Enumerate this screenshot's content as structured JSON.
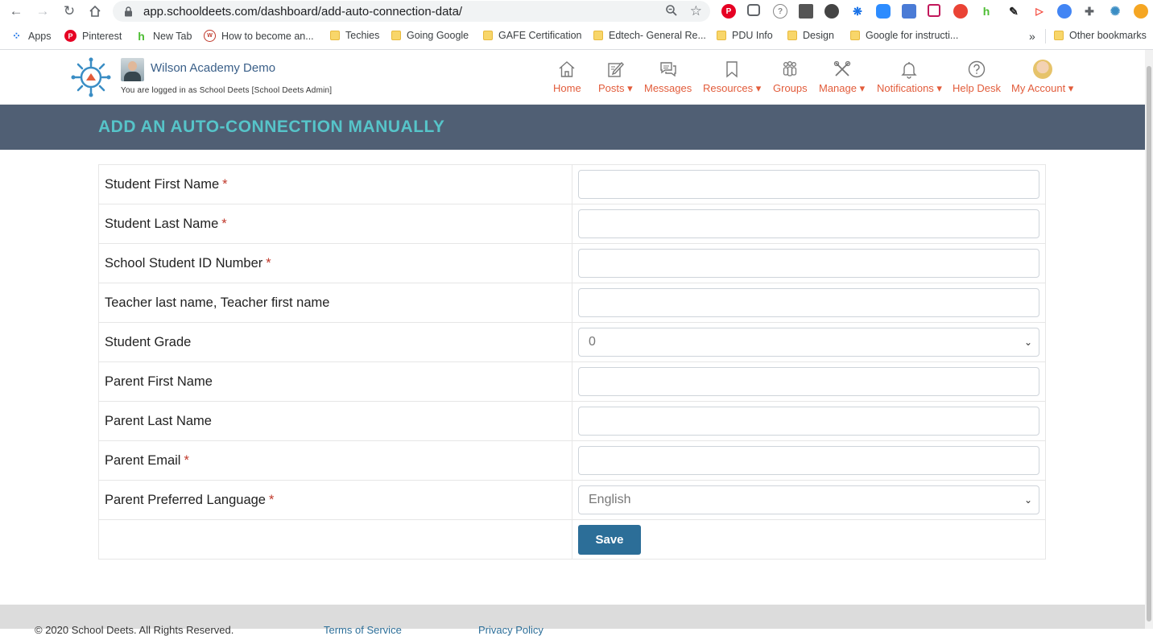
{
  "browser": {
    "url": "app.schooldeets.com/dashboard/add-auto-connection-data/",
    "bookmarks": [
      {
        "label": "Apps",
        "icon": "apps-grid-icon"
      },
      {
        "label": "Pinterest",
        "icon": "pinterest-icon"
      },
      {
        "label": "New Tab",
        "icon": "houzz-icon"
      },
      {
        "label": "How to become an...",
        "icon": "site-icon"
      },
      {
        "label": "Techies",
        "icon": "folder-icon"
      },
      {
        "label": "Going Google",
        "icon": "folder-icon"
      },
      {
        "label": "GAFE Certification",
        "icon": "folder-icon"
      },
      {
        "label": "Edtech- General Re...",
        "icon": "folder-icon"
      },
      {
        "label": "PDU Info",
        "icon": "folder-icon"
      },
      {
        "label": "Design",
        "icon": "folder-icon"
      },
      {
        "label": "Google for instructi...",
        "icon": "folder-icon"
      }
    ],
    "overflow": "»",
    "other_bookmarks": "Other bookmarks"
  },
  "header": {
    "org_name": "Wilson Academy Demo",
    "logged_in_text": "You are logged in as School Deets [School Deets Admin]",
    "nav": [
      {
        "label": "Home",
        "icon": "home-icon"
      },
      {
        "label": "Posts ▾",
        "icon": "edit-icon"
      },
      {
        "label": "Messages",
        "icon": "chat-icon"
      },
      {
        "label": "Resources ▾",
        "icon": "bookmark-icon"
      },
      {
        "label": "Groups",
        "icon": "group-icon"
      },
      {
        "label": "Manage ▾",
        "icon": "tools-icon"
      },
      {
        "label": "Notifications ▾",
        "icon": "bell-icon"
      },
      {
        "label": "Help Desk",
        "icon": "help-icon"
      },
      {
        "label": "My Account ▾",
        "icon": "avatar-icon"
      }
    ]
  },
  "page": {
    "title": "ADD AN AUTO-CONNECTION MANUALLY"
  },
  "form": {
    "fields": [
      {
        "label": "Student First Name",
        "required": "*",
        "type": "text",
        "value": ""
      },
      {
        "label": "Student Last Name",
        "required": "*",
        "type": "text",
        "value": ""
      },
      {
        "label": "School Student ID Number",
        "required": "*",
        "type": "text",
        "value": ""
      },
      {
        "label": "Teacher last name, Teacher first name",
        "required": "",
        "type": "text",
        "value": ""
      },
      {
        "label": "Student Grade",
        "required": "",
        "type": "select",
        "value": "0"
      },
      {
        "label": "Parent First Name",
        "required": "",
        "type": "text",
        "value": ""
      },
      {
        "label": "Parent Last Name",
        "required": "",
        "type": "text",
        "value": ""
      },
      {
        "label": "Parent Email",
        "required": "*",
        "type": "text",
        "value": ""
      },
      {
        "label": "Parent Preferred Language",
        "required": "*",
        "type": "select",
        "value": "English"
      }
    ],
    "save_label": "Save"
  },
  "footer": {
    "copyright": "© 2020 School Deets. All Rights Reserved.",
    "terms": "Terms of Service",
    "privacy": "Privacy Policy"
  },
  "colors": {
    "title_band": "#505f74",
    "title_text": "#56c4c9",
    "nav_text": "#e25c3b",
    "save_button": "#2c6e98"
  }
}
